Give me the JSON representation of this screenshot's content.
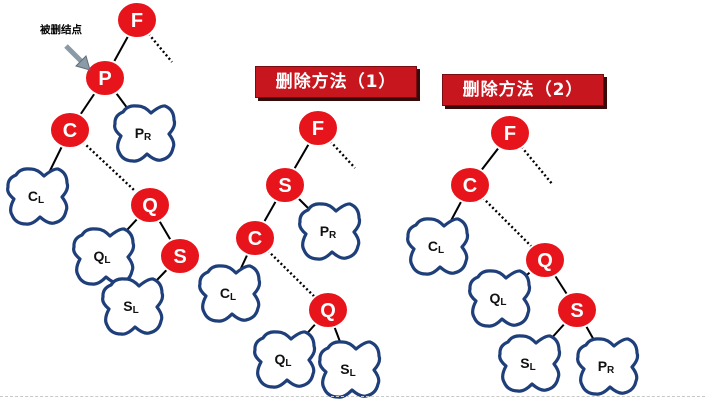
{
  "annotation": {
    "deleted_node_label": "被删结点"
  },
  "banners": {
    "method1": "删除方法（1）",
    "method2": "删除方法（2）"
  },
  "colors": {
    "node_fill": "#e8141b",
    "node_stroke": "#ffffff",
    "subtree_stroke": "#1f3f7a",
    "banner_fill": "#c8161e",
    "edge": "#000000",
    "arrow": "#8a9aa6"
  },
  "trees": [
    {
      "id": "original",
      "nodes": [
        {
          "key": "F",
          "label": "F"
        },
        {
          "key": "P",
          "label": "P"
        },
        {
          "key": "C",
          "label": "C"
        },
        {
          "key": "Q",
          "label": "Q"
        },
        {
          "key": "S",
          "label": "S"
        }
      ],
      "subtrees": [
        {
          "key": "PR",
          "main": "P",
          "sub": "R"
        },
        {
          "key": "CL",
          "main": "C",
          "sub": "L"
        },
        {
          "key": "QL",
          "main": "Q",
          "sub": "L"
        },
        {
          "key": "SL",
          "main": "S",
          "sub": "L"
        }
      ],
      "edges": [
        {
          "from": "F",
          "to": "P",
          "style": "solid"
        },
        {
          "from": "F",
          "to": "F-right",
          "style": "dotted"
        },
        {
          "from": "P",
          "to": "C",
          "style": "solid"
        },
        {
          "from": "P",
          "to": "PR",
          "style": "solid"
        },
        {
          "from": "C",
          "to": "CL",
          "style": "solid"
        },
        {
          "from": "C",
          "to": "Q",
          "style": "dotted"
        },
        {
          "from": "Q",
          "to": "QL",
          "style": "solid"
        },
        {
          "from": "Q",
          "to": "S",
          "style": "solid"
        },
        {
          "from": "S",
          "to": "SL",
          "style": "solid"
        }
      ]
    },
    {
      "id": "method1",
      "nodes": [
        {
          "key": "F",
          "label": "F"
        },
        {
          "key": "S",
          "label": "S"
        },
        {
          "key": "C",
          "label": "C"
        },
        {
          "key": "Q",
          "label": "Q"
        }
      ],
      "subtrees": [
        {
          "key": "PR",
          "main": "P",
          "sub": "R"
        },
        {
          "key": "CL",
          "main": "C",
          "sub": "L"
        },
        {
          "key": "QL",
          "main": "Q",
          "sub": "L"
        },
        {
          "key": "SL",
          "main": "S",
          "sub": "L"
        }
      ],
      "edges": [
        {
          "from": "F",
          "to": "S",
          "style": "solid"
        },
        {
          "from": "F",
          "to": "F-right",
          "style": "dotted"
        },
        {
          "from": "S",
          "to": "C",
          "style": "solid"
        },
        {
          "from": "S",
          "to": "PR",
          "style": "solid"
        },
        {
          "from": "C",
          "to": "CL",
          "style": "solid"
        },
        {
          "from": "C",
          "to": "Q",
          "style": "dotted"
        },
        {
          "from": "Q",
          "to": "QL",
          "style": "solid"
        },
        {
          "from": "Q",
          "to": "SL",
          "style": "solid"
        }
      ]
    },
    {
      "id": "method2",
      "nodes": [
        {
          "key": "F",
          "label": "F"
        },
        {
          "key": "C",
          "label": "C"
        },
        {
          "key": "Q",
          "label": "Q"
        },
        {
          "key": "S",
          "label": "S"
        }
      ],
      "subtrees": [
        {
          "key": "CL",
          "main": "C",
          "sub": "L"
        },
        {
          "key": "QL",
          "main": "Q",
          "sub": "L"
        },
        {
          "key": "SL",
          "main": "S",
          "sub": "L"
        },
        {
          "key": "PR",
          "main": "P",
          "sub": "R"
        }
      ],
      "edges": [
        {
          "from": "F",
          "to": "C",
          "style": "solid"
        },
        {
          "from": "F",
          "to": "F-right",
          "style": "dotted"
        },
        {
          "from": "C",
          "to": "CL",
          "style": "solid"
        },
        {
          "from": "C",
          "to": "Q",
          "style": "dotted"
        },
        {
          "from": "Q",
          "to": "QL",
          "style": "solid"
        },
        {
          "from": "Q",
          "to": "S",
          "style": "solid"
        },
        {
          "from": "S",
          "to": "SL",
          "style": "solid"
        },
        {
          "from": "S",
          "to": "PR",
          "style": "solid"
        }
      ]
    }
  ]
}
